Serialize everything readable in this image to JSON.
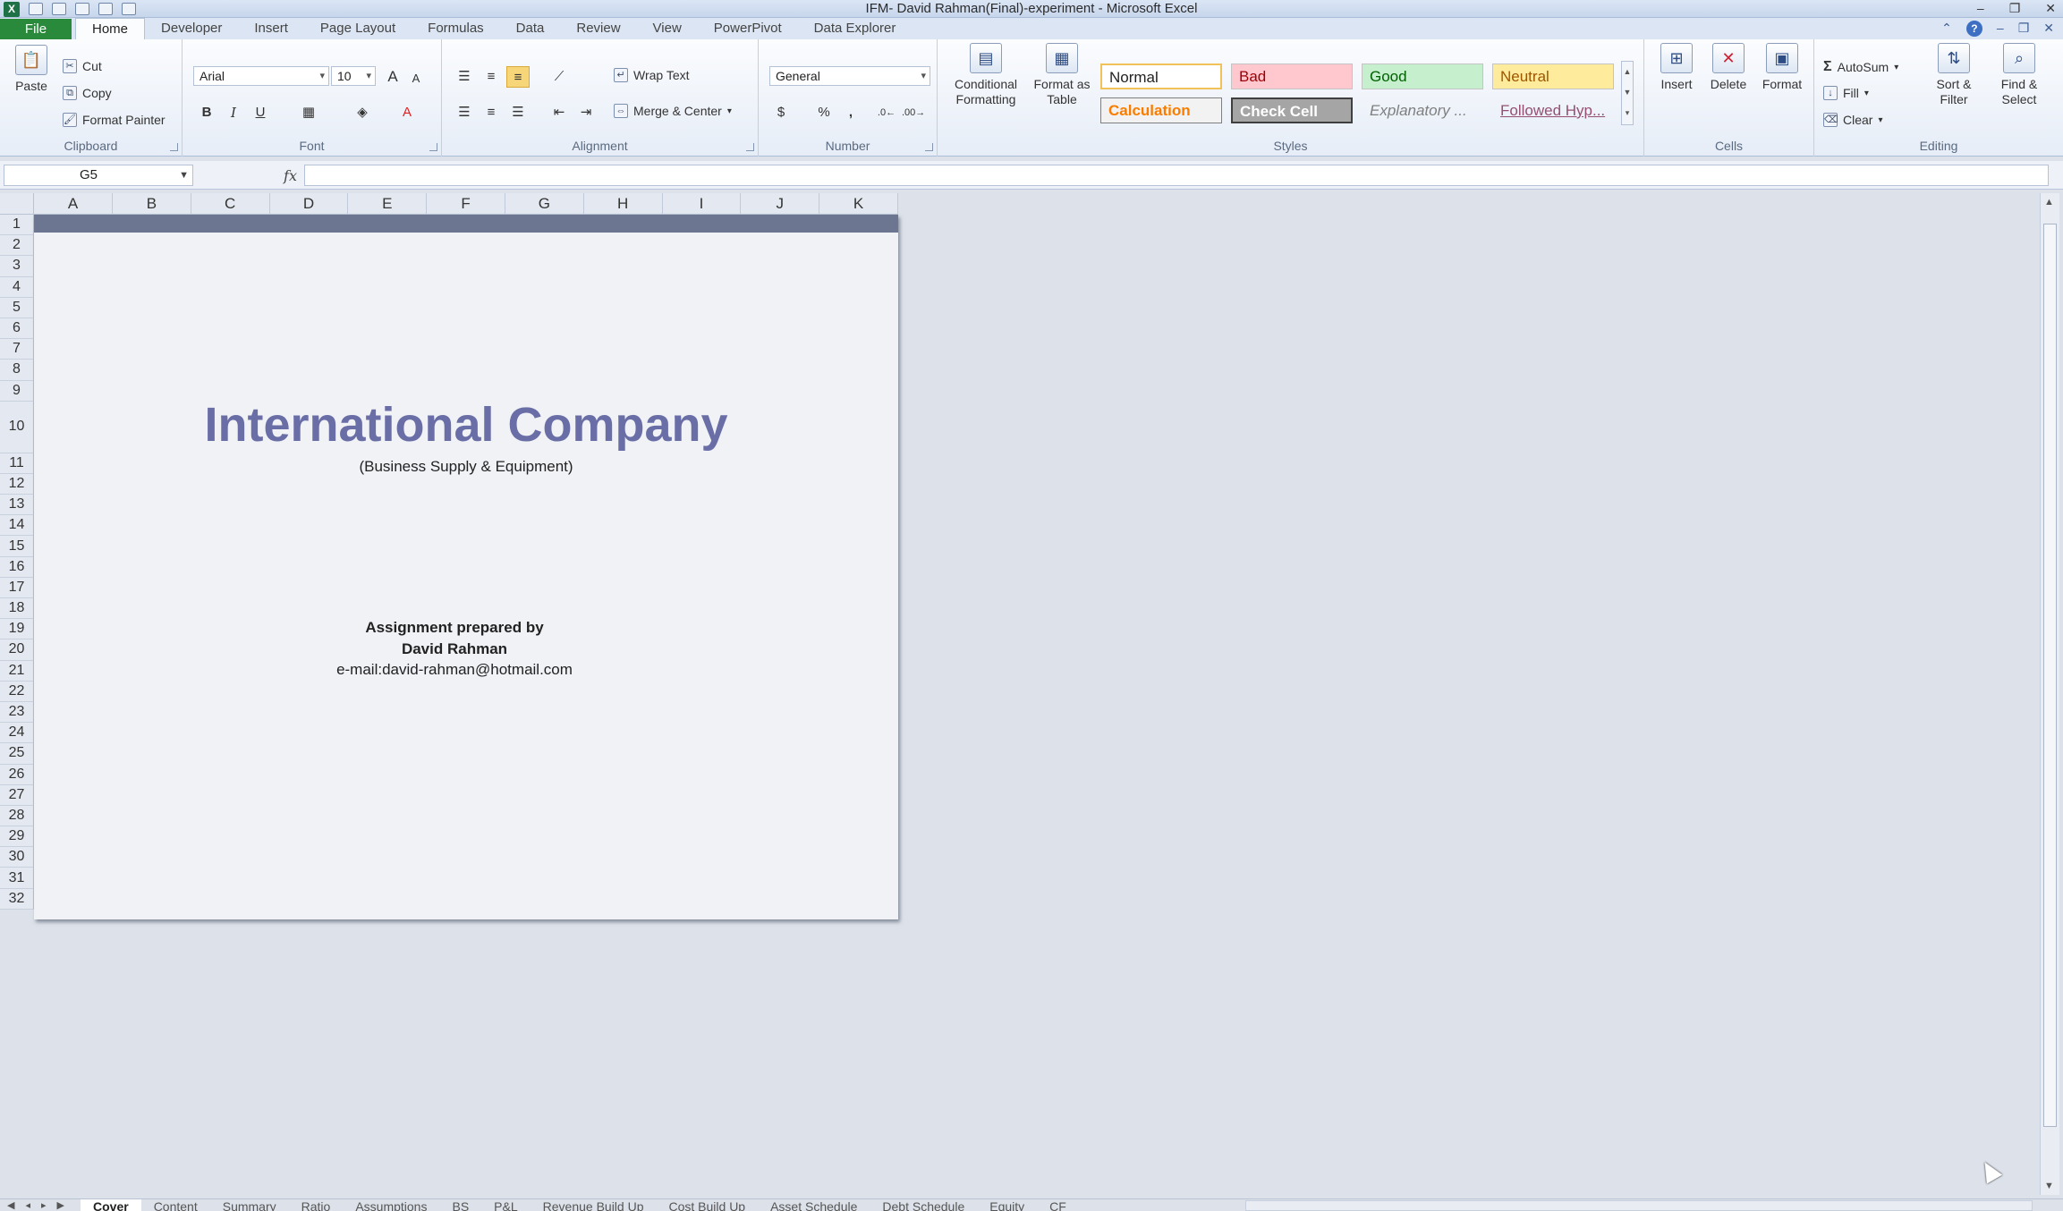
{
  "window": {
    "title": "IFM- David Rahman(Final)-experiment - Microsoft Excel",
    "controls": [
      "–",
      "❐",
      "✕"
    ]
  },
  "ribbon_tabs": {
    "file": "File",
    "items": [
      "Home",
      "Developer",
      "Insert",
      "Page Layout",
      "Formulas",
      "Data",
      "Review",
      "View",
      "PowerPivot",
      "Data Explorer"
    ],
    "active": "Home"
  },
  "clipboard": {
    "label": "Clipboard",
    "paste": "Paste",
    "cut": "Cut",
    "copy": "Copy",
    "format_painter": "Format Painter"
  },
  "font": {
    "label": "Font",
    "name": "Arial",
    "size": "10",
    "bold": "B",
    "italic": "I",
    "underline": "U",
    "grow": "A",
    "shrink": "A"
  },
  "alignment": {
    "label": "Alignment",
    "wrap_text": "Wrap Text",
    "merge_center": "Merge & Center"
  },
  "number": {
    "label": "Number",
    "format": "General",
    "percent": "%",
    "comma": ","
  },
  "styles": {
    "label": "Styles",
    "conditional_formatting": "Conditional Formatting",
    "format_as_table": "Format as Table",
    "normal": "Normal",
    "bad": "Bad",
    "good": "Good",
    "neutral": "Neutral",
    "calculation": "Calculation",
    "check_cell": "Check Cell",
    "explanatory": "Explanatory ...",
    "followed_hyp": "Followed Hyp..."
  },
  "cells": {
    "label": "Cells",
    "insert": "Insert",
    "delete": "Delete",
    "format": "Format"
  },
  "editing": {
    "label": "Editing",
    "autosum": "AutoSum",
    "fill": "Fill",
    "clear": "Clear",
    "sort_filter": "Sort & Filter",
    "find_select": "Find & Select"
  },
  "formula_bar": {
    "name_box": "G5",
    "fx": "fx",
    "content": ""
  },
  "grid": {
    "columns": [
      "A",
      "B",
      "C",
      "D",
      "E",
      "F",
      "G",
      "H",
      "I",
      "J",
      "K"
    ],
    "rows": [
      "1",
      "2",
      "3",
      "4",
      "5",
      "6",
      "7",
      "8",
      "9",
      "10",
      "11",
      "12",
      "13",
      "14",
      "15",
      "16",
      "17",
      "18",
      "19",
      "20",
      "21",
      "22",
      "23",
      "24",
      "25",
      "26",
      "27",
      "28",
      "29",
      "30",
      "31",
      "32"
    ]
  },
  "cover": {
    "company": "International Company",
    "subtitle": "(Business Supply & Equipment)",
    "prepared_by": "Assignment prepared by",
    "author": "David Rahman",
    "email": "e-mail:david-rahman@hotmail.com"
  },
  "sheet_tabs": {
    "items": [
      "Cover",
      "Content",
      "Summary",
      "Ratio",
      "Assumptions",
      "BS",
      "P&L",
      "Revenue Build Up",
      "Cost Build Up",
      "Asset Schedule",
      "Debt Schedule",
      "Equity",
      "CF"
    ],
    "active": "Cover"
  },
  "colors": {
    "company_title": "#6a6ea6",
    "header_band": "#6d7690",
    "file_tab": "#2a8a3c",
    "style_bad": "#ffc7ce",
    "style_good": "#c6efce",
    "style_neutral": "#ffeb9c",
    "style_check_cell": "#a5a5a5"
  }
}
